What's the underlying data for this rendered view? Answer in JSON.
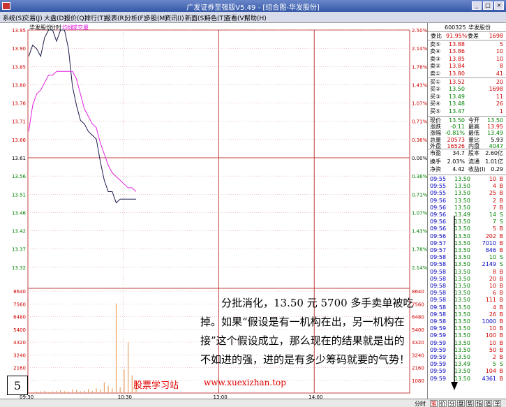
{
  "window": {
    "title": "广发证券至强版V5.49 - [组合图-华发股份]"
  },
  "menu": [
    "系统(S)",
    "交易(J)",
    "大盘(D)",
    "报价(Q)",
    "排行(T)",
    "报表(R)",
    "分析(F)",
    "多股(M)",
    "资讯(I)",
    "新面(S)",
    "特色(T)",
    "查看(V)",
    "帮助(H)"
  ],
  "chart_header": {
    "stock": "华发股份",
    "period": "分时",
    "legend_avg": "均线",
    "legend_vol": "成交量"
  },
  "chart_data": {
    "type": "line",
    "y_price_ticks": [
      "13.95",
      "13.90",
      "13.85",
      "13.80",
      "13.76",
      "13.71",
      "13.66",
      "13.61",
      "13.56",
      "13.51",
      "13.46",
      "13.42",
      "13.37",
      "13.32"
    ],
    "y_pct_ticks": [
      "2.50%",
      "2.14%",
      "1.78%",
      "1.43%",
      "1.07%",
      "0.71%",
      "0.36%",
      "0.00%",
      "0.36%",
      "0.71%",
      "1.07%",
      "1.43%",
      "1.78%",
      "2.14%"
    ],
    "ylim": [
      13.27,
      13.95
    ],
    "prev_close": 13.61,
    "vol_ticks": [
      "8640",
      "7560",
      "6480",
      "5400",
      "4320",
      "3240",
      "2160",
      "1080"
    ],
    "vol_max": 8640,
    "x_ticks": [
      "09:30",
      "10:30",
      "13:00",
      "14:00"
    ],
    "x_count": 240,
    "series": [
      {
        "name": "",
        "color": "#1a1a4a",
        "values": [
          13.88,
          13.91,
          13.9,
          13.88,
          13.93,
          13.95,
          13.95,
          13.92,
          13.95,
          13.95,
          13.9,
          13.8,
          13.75,
          13.71,
          13.7,
          13.68,
          13.67,
          13.66,
          13.6,
          13.55,
          13.52,
          13.52,
          13.49,
          13.5,
          13.5,
          13.5,
          13.5,
          13.5
        ]
      },
      {
        "name": "均线",
        "color": "#e020e0",
        "values": [
          13.68,
          13.75,
          13.78,
          13.79,
          13.81,
          13.83,
          13.83,
          13.84,
          13.84,
          13.84,
          13.84,
          13.84,
          13.82,
          13.78,
          13.74,
          13.72,
          13.7,
          13.69,
          13.65,
          13.62,
          13.59,
          13.57,
          13.56,
          13.55,
          13.54,
          13.53,
          13.53,
          13.52
        ]
      }
    ],
    "volume": [
      80,
      60,
      120,
      150,
      200,
      90,
      140,
      180,
      220,
      160,
      120,
      300,
      250,
      150,
      200,
      350,
      180,
      400,
      300,
      900,
      600,
      400,
      7600,
      500,
      2000,
      4300,
      1500,
      1100
    ]
  },
  "quote": {
    "code": "600325",
    "name": "华发股份",
    "webi_label": "委比",
    "webi": "91.95%",
    "wecha_label": "委差",
    "wecha": "1698",
    "asks": [
      {
        "label": "卖⑤",
        "price": "13.88",
        "vol": "5"
      },
      {
        "label": "卖④",
        "price": "13.86",
        "vol": "10"
      },
      {
        "label": "卖③",
        "price": "13.85",
        "vol": "10"
      },
      {
        "label": "卖②",
        "price": "13.84",
        "vol": "8"
      },
      {
        "label": "卖①",
        "price": "13.80",
        "vol": "41"
      }
    ],
    "bids": [
      {
        "label": "买①",
        "price": "13.52",
        "vol": "20"
      },
      {
        "label": "买②",
        "price": "13.50",
        "vol": "1698"
      },
      {
        "label": "买③",
        "price": "13.49",
        "vol": "11"
      },
      {
        "label": "买④",
        "price": "13.48",
        "vol": "26"
      },
      {
        "label": "买⑤",
        "price": "13.47",
        "vol": "1"
      }
    ],
    "stats": [
      {
        "l1": "现价",
        "v1": "13.50",
        "c1": "green",
        "l2": "今开",
        "v2": "13.50",
        "c2": "green"
      },
      {
        "l1": "涨跌",
        "v1": "-0.11",
        "c1": "green",
        "l2": "最高",
        "v2": "13.95",
        "c2": "red"
      },
      {
        "l1": "涨幅",
        "v1": "-0.81%",
        "c1": "green",
        "l2": "最低",
        "v2": "13.49",
        "c2": "green"
      },
      {
        "l1": "总量",
        "v1": "20573",
        "c1": "red",
        "l2": "量比",
        "v2": "5.93",
        "c2": "black"
      },
      {
        "l1": "外盘",
        "v1": "16526",
        "c1": "red",
        "l2": "内盘",
        "v2": "4047",
        "c2": "green"
      }
    ],
    "stats2": [
      {
        "l1": "市盈",
        "v1": "34.7",
        "l2": "股本",
        "v2": "2.60亿"
      },
      {
        "l1": "换手",
        "v1": "2.03%",
        "l2": "流通",
        "v2": "1.01亿"
      },
      {
        "l1": "净资",
        "v1": "4.42",
        "l2": "收益(I)",
        "v2": "0.29"
      }
    ]
  },
  "ticks": [
    {
      "t": "09:55",
      "p": "13.50",
      "v": "10",
      "d": "B"
    },
    {
      "t": "09:55",
      "p": "13.50",
      "v": "4",
      "d": "B"
    },
    {
      "t": "09:55",
      "p": "13.50",
      "v": "25",
      "d": "B"
    },
    {
      "t": "09:56",
      "p": "13.50",
      "v": "2",
      "d": "B"
    },
    {
      "t": "09:56",
      "p": "13.50",
      "v": "7",
      "d": "B"
    },
    {
      "t": "09:56",
      "p": "13.49",
      "v": "14",
      "d": "S"
    },
    {
      "t": "09:56",
      "p": "13.50",
      "v": "7",
      "d": "S"
    },
    {
      "t": "09:56",
      "p": "13.50",
      "v": "5",
      "d": "B"
    },
    {
      "t": "09:56",
      "p": "13.50",
      "v": "202",
      "d": "B"
    },
    {
      "t": "09:57",
      "p": "13.50",
      "v": "7010",
      "d": "B"
    },
    {
      "t": "09:57",
      "p": "13.50",
      "v": "846",
      "d": "B"
    },
    {
      "t": "09:58",
      "p": "13.50",
      "v": "10",
      "d": "S"
    },
    {
      "t": "09:58",
      "p": "13.50",
      "v": "2149",
      "d": "S"
    },
    {
      "t": "09:58",
      "p": "13.50",
      "v": "8",
      "d": "B"
    },
    {
      "t": "09:58",
      "p": "13.50",
      "v": "20",
      "d": "B"
    },
    {
      "t": "09:58",
      "p": "13.50",
      "v": "10",
      "d": "B"
    },
    {
      "t": "09:58",
      "p": "13.50",
      "v": "6",
      "d": "B"
    },
    {
      "t": "09:58",
      "p": "13.50",
      "v": "111",
      "d": "B"
    },
    {
      "t": "09:58",
      "p": "13.50",
      "v": "4",
      "d": "B"
    },
    {
      "t": "09:58",
      "p": "13.50",
      "v": "26",
      "d": "B"
    },
    {
      "t": "09:58",
      "p": "13.50",
      "v": "1000",
      "d": "B"
    },
    {
      "t": "09:59",
      "p": "13.50",
      "v": "10",
      "d": "B"
    },
    {
      "t": "09:59",
      "p": "13.50",
      "v": "100",
      "d": "B"
    },
    {
      "t": "09:59",
      "p": "13.50",
      "v": "10",
      "d": "B"
    },
    {
      "t": "09:59",
      "p": "13.50",
      "v": "50",
      "d": "B"
    },
    {
      "t": "09:59",
      "p": "13.50",
      "v": "2",
      "d": "B"
    },
    {
      "t": "09:59",
      "p": "13.49",
      "v": "5",
      "d": "S"
    },
    {
      "t": "09:59",
      "p": "13.50",
      "v": "104",
      "d": "B"
    },
    {
      "t": "09:59",
      "p": "13.50",
      "v": "4361",
      "d": "B"
    }
  ],
  "annotation": "分批消化，13.50 元 5700 多手卖单被吃掉。如果“假设是有一机构在出，另一机构在接”这个假设成立，那么现在的结果就是出的不如进的强，进的是有多少筹码就要的气势！",
  "page_number": "5",
  "watermark": {
    "site": "股票学习站",
    "url": "www.xuexizhan.top"
  },
  "bottom": {
    "label": "分时",
    "tabs": [
      "笔",
      "价",
      "分",
      "盘",
      "势",
      "指",
      "值",
      "单"
    ]
  }
}
